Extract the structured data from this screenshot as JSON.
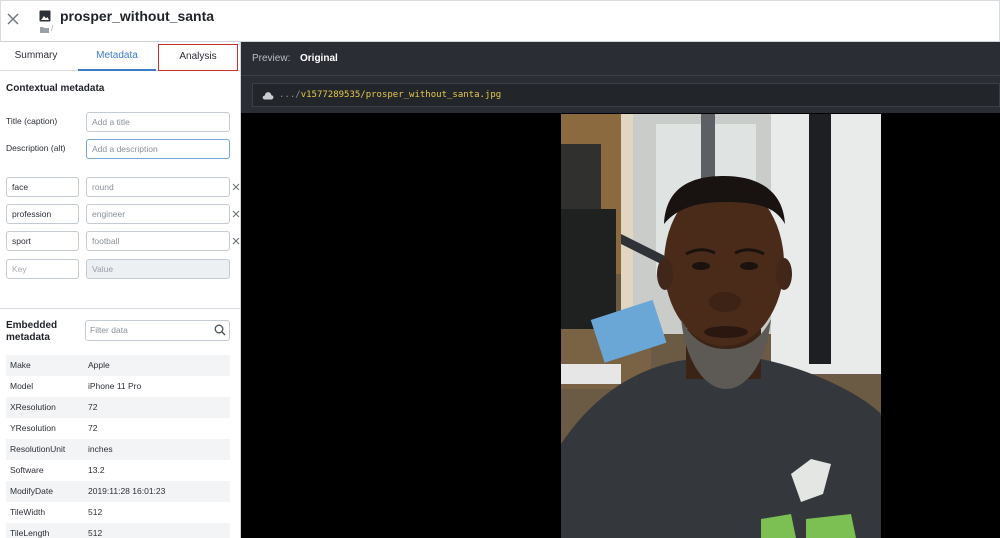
{
  "header": {
    "title": "prosper_without_santa",
    "folder_path": "/"
  },
  "tabs": [
    {
      "label": "Summary"
    },
    {
      "label": "Metadata"
    },
    {
      "label": "Analysis"
    }
  ],
  "contextual": {
    "title": "Contextual metadata",
    "title_label": "Title (caption)",
    "title_placeholder": "Add a title",
    "description_label": "Description (alt)",
    "description_placeholder": "Add a description",
    "pairs": [
      {
        "key": "face",
        "value": "round"
      },
      {
        "key": "profession",
        "value": "engineer"
      },
      {
        "key": "sport",
        "value": "football"
      }
    ],
    "new_key_placeholder": "Key",
    "new_value_placeholder": "Value"
  },
  "embedded": {
    "title": "Embedded metadata",
    "filter_placeholder": "Filter data",
    "rows": [
      {
        "key": "Make",
        "value": "Apple"
      },
      {
        "key": "Model",
        "value": "iPhone 11 Pro"
      },
      {
        "key": "XResolution",
        "value": "72"
      },
      {
        "key": "YResolution",
        "value": "72"
      },
      {
        "key": "ResolutionUnit",
        "value": "inches"
      },
      {
        "key": "Software",
        "value": "13.2"
      },
      {
        "key": "ModifyDate",
        "value": "2019:11:28 16:01:23"
      },
      {
        "key": "TileWidth",
        "value": "512"
      },
      {
        "key": "TileLength",
        "value": "512"
      }
    ]
  },
  "preview": {
    "label": "Preview:",
    "value": "Original",
    "url_prefix": ".../",
    "url_path": "v1577289535/prosper_without_santa.jpg"
  },
  "colors": {
    "accent": "#3f7bc7",
    "highlight_border": "#c8302d",
    "dark_panel": "#2a2e34",
    "url_highlight": "#e6c84a"
  },
  "icons": [
    "close-icon",
    "image-file-icon",
    "folder-icon",
    "remove-icon",
    "search-icon",
    "cloud-icon"
  ]
}
